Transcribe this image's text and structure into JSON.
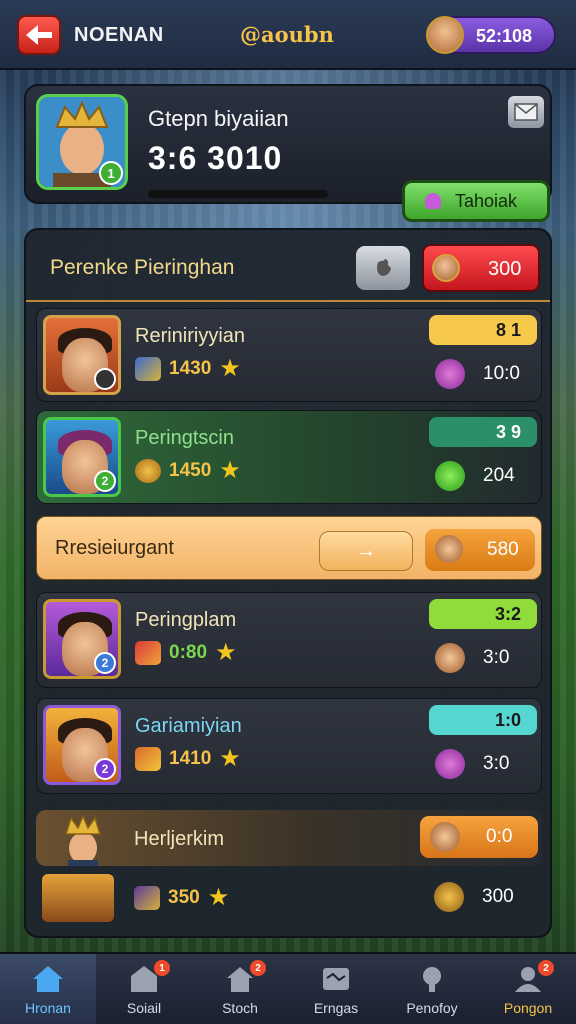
{
  "top": {
    "title": "NOENAN",
    "logo": "@aoubn",
    "currency": "52:108"
  },
  "hero": {
    "name": "Gtepn biyaiian",
    "score": "3:6 3010",
    "level": "1",
    "action_label": "Tahoiak"
  },
  "list": {
    "title": "Perenke Pieringhan",
    "header_value": "300"
  },
  "rows": [
    {
      "name": "Reriniriyyian",
      "stat": "1430",
      "score": "8 1",
      "value": "10:0",
      "level": "",
      "score_color": "#f6c94a"
    },
    {
      "name": "Peringtscin",
      "stat": "1450",
      "score": "3 9",
      "value": "204",
      "level": "2",
      "score_color": "#2b8f6a"
    },
    {
      "name": "Peringplam",
      "stat": "0:80",
      "score": "3:2",
      "value": "3:0",
      "level": "2",
      "score_color": "#8fdc3a"
    },
    {
      "name": "Gariamiyian",
      "stat": "1410",
      "score": "1:0",
      "value": "3:0",
      "level": "2",
      "score_color": "#55d6d0"
    }
  ],
  "banner": {
    "text": "Rresieiurgant",
    "arrow": "→",
    "value": "580"
  },
  "special": {
    "name": "Herljerkim",
    "value": "0:0"
  },
  "partial": {
    "stat": "350",
    "value": "300"
  },
  "nav": [
    {
      "label": "Hronan",
      "icon": "home-icon",
      "badge": ""
    },
    {
      "label": "Soiail",
      "icon": "social-icon",
      "badge": "1"
    },
    {
      "label": "Stoch",
      "icon": "store-icon",
      "badge": "2"
    },
    {
      "label": "Erngas",
      "icon": "events-icon",
      "badge": ""
    },
    {
      "label": "Penofoy",
      "icon": "trophy-icon",
      "badge": ""
    },
    {
      "label": "Pongon",
      "icon": "profile-icon",
      "badge": "2"
    }
  ]
}
